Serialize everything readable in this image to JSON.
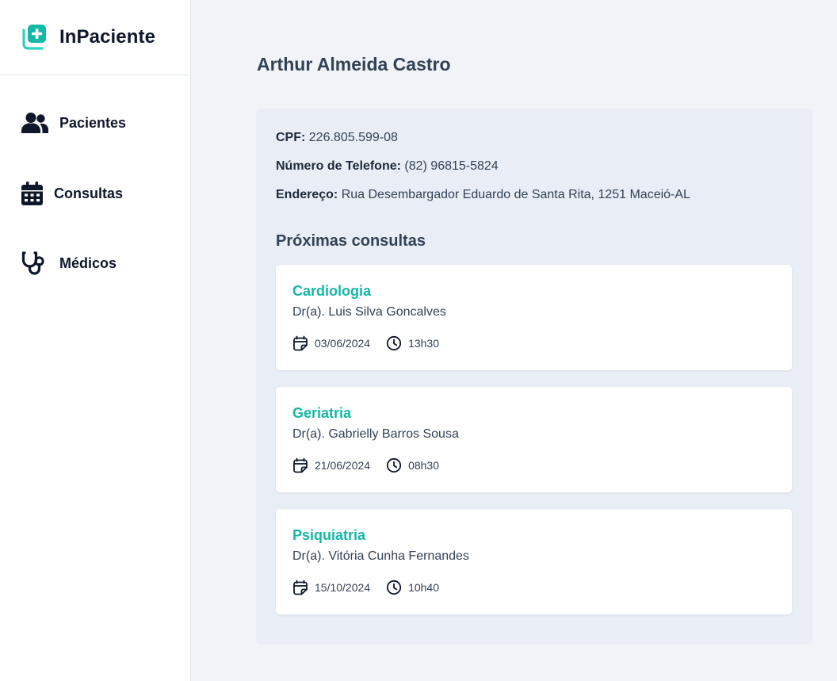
{
  "app": {
    "name": "InPaciente",
    "accent": "#14b8a6"
  },
  "sidebar": {
    "items": [
      {
        "label": "Pacientes",
        "icon": "users-icon"
      },
      {
        "label": "Consultas",
        "icon": "calendar-icon"
      },
      {
        "label": "Médicos",
        "icon": "stethoscope-icon"
      }
    ]
  },
  "patient": {
    "name": "Arthur Almeida Castro",
    "cpf_label": "CPF:",
    "cpf": "226.805.599-08",
    "phone_label": "Número de Telefone:",
    "phone": "(82) 96815-5824",
    "address_label": "Endereço:",
    "address": "Rua Desembargador Eduardo de Santa Rita, 1251 Maceió-AL"
  },
  "appointments": {
    "title": "Próximas consultas",
    "items": [
      {
        "specialty": "Cardiologia",
        "doctor": "Dr(a). Luis Silva Goncalves",
        "date": "03/06/2024",
        "time": "13h30"
      },
      {
        "specialty": "Geriatria",
        "doctor": "Dr(a). Gabrielly Barros Sousa",
        "date": "21/06/2024",
        "time": "08h30"
      },
      {
        "specialty": "Psiquiatria",
        "doctor": "Dr(a). Vitória Cunha Fernandes",
        "date": "15/10/2024",
        "time": "10h40"
      }
    ]
  }
}
